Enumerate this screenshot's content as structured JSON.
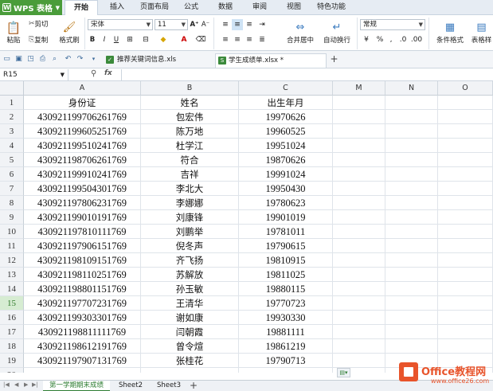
{
  "app": {
    "name": "WPS 表格"
  },
  "menu": {
    "tabs": [
      "开始",
      "插入",
      "页面布局",
      "公式",
      "数据",
      "审阅",
      "视图",
      "特色功能"
    ],
    "active": "开始"
  },
  "ribbon": {
    "paste": "粘贴",
    "cut": "剪切",
    "copy": "复制",
    "format_painter": "格式刷",
    "font_name": "宋体",
    "font_size": "11",
    "bold": "B",
    "italic": "I",
    "underline": "U",
    "merge_center": "合并居中",
    "wrap_text": "自动换行",
    "number_format": "常规",
    "conditional_format": "条件格式",
    "table_style": "表格样"
  },
  "tabs": [
    {
      "label": "推荐关键词信息.xls"
    },
    {
      "label": "学生成绩单.xlsx *"
    }
  ],
  "formula_bar": {
    "name_box": "R15",
    "fx": "fx",
    "content": ""
  },
  "columns": [
    "A",
    "B",
    "C",
    "M",
    "N",
    "O"
  ],
  "rows": [
    {
      "n": "1",
      "a": "身份证",
      "b": "姓名",
      "c": "出生年月"
    },
    {
      "n": "2",
      "a": "430921199706261769",
      "b": "包宏伟",
      "c": "19970626"
    },
    {
      "n": "3",
      "a": "430921199605251769",
      "b": "陈万地",
      "c": "19960525"
    },
    {
      "n": "4",
      "a": "430921199510241769",
      "b": "杜学江",
      "c": "19951024"
    },
    {
      "n": "5",
      "a": "430921198706261769",
      "b": "符合",
      "c": "19870626"
    },
    {
      "n": "6",
      "a": "430921199910241769",
      "b": "吉祥",
      "c": "19991024"
    },
    {
      "n": "7",
      "a": "430921199504301769",
      "b": "李北大",
      "c": "19950430"
    },
    {
      "n": "8",
      "a": "430921197806231769",
      "b": "李娜娜",
      "c": "19780623"
    },
    {
      "n": "9",
      "a": "430921199010191769",
      "b": "刘康锋",
      "c": "19901019"
    },
    {
      "n": "10",
      "a": "430921197810111769",
      "b": "刘鹏举",
      "c": "19781011"
    },
    {
      "n": "11",
      "a": "430921197906151769",
      "b": "倪冬声",
      "c": "19790615"
    },
    {
      "n": "12",
      "a": "430921198109151769",
      "b": "齐飞扬",
      "c": "19810915"
    },
    {
      "n": "13",
      "a": "430921198110251769",
      "b": "苏解放",
      "c": "19811025"
    },
    {
      "n": "14",
      "a": "430921198801151769",
      "b": "孙玉敏",
      "c": "19880115"
    },
    {
      "n": "15",
      "a": "430921197707231769",
      "b": "王清华",
      "c": "19770723"
    },
    {
      "n": "16",
      "a": "430921199303301769",
      "b": "谢如康",
      "c": "19930330"
    },
    {
      "n": "17",
      "a": "430921198811111769",
      "b": "闫朝霞",
      "c": "19881111"
    },
    {
      "n": "18",
      "a": "430921198612191769",
      "b": "曾令煊",
      "c": "19861219"
    },
    {
      "n": "19",
      "a": "430921197907131769",
      "b": "张桂花",
      "c": "19790713"
    },
    {
      "n": "20",
      "a": "",
      "b": "",
      "c": ""
    }
  ],
  "active_row": "15",
  "sheets": [
    "第一学期期末成绩",
    "Sheet2",
    "Sheet3"
  ],
  "active_sheet": "第一学期期末成绩",
  "watermark": {
    "title": "Office教程网",
    "url": "www.office26.com"
  },
  "colors": {
    "accent": "#4a9c3a",
    "active_sheet": "#2e7d32",
    "watermark": "#e8542b"
  }
}
